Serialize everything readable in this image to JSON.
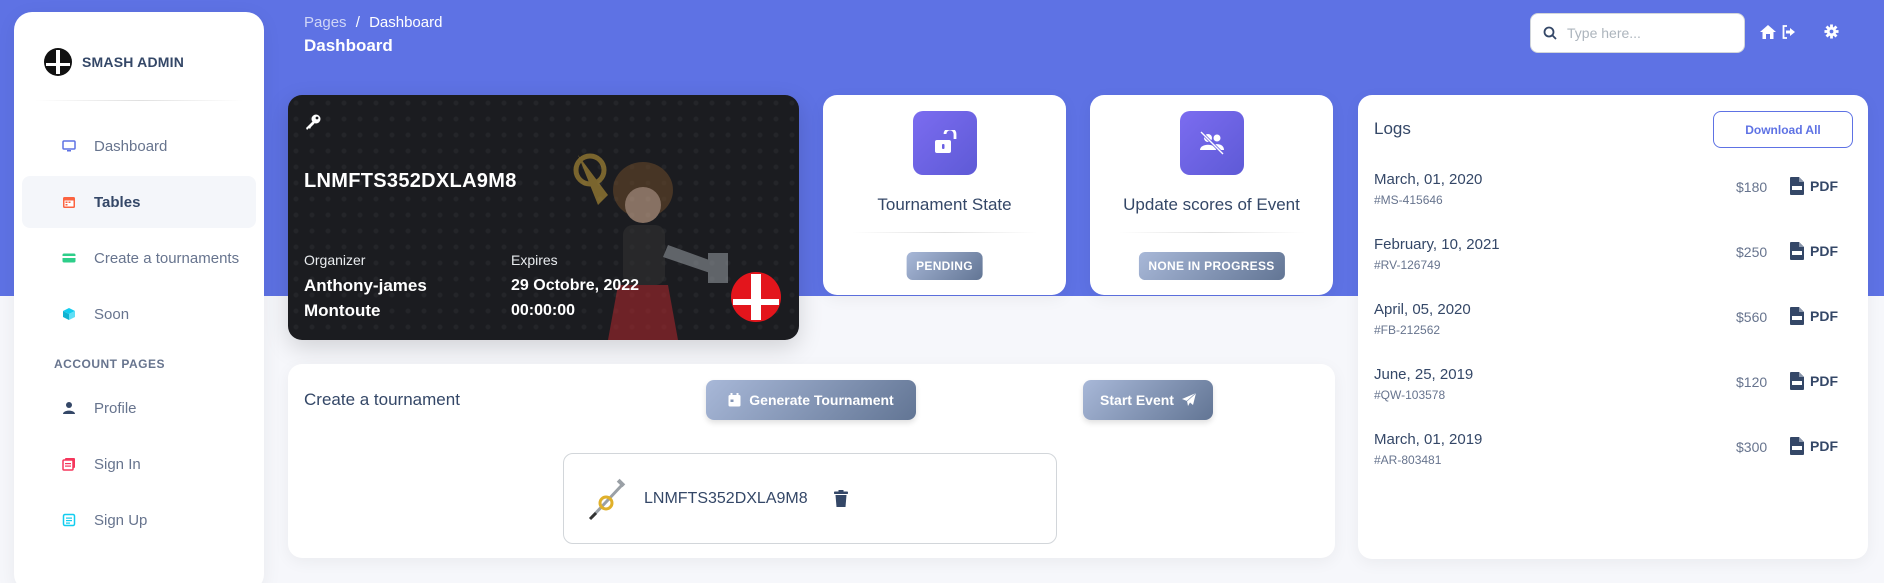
{
  "sidebar": {
    "brand": "SMASH ADMIN",
    "items": [
      {
        "label": "Dashboard",
        "icon": "desktop-icon",
        "color": "#5e72e4"
      },
      {
        "label": "Tables",
        "icon": "calendar-icon",
        "color": "#fb6340"
      },
      {
        "label": "Create a tournaments",
        "icon": "credit-card-icon",
        "color": "#2dce89"
      },
      {
        "label": "Soon",
        "icon": "cube-icon",
        "color": "#11cdef"
      }
    ],
    "section_label": "ACCOUNT PAGES",
    "account_items": [
      {
        "label": "Profile",
        "icon": "user-icon",
        "color": "#344767"
      },
      {
        "label": "Sign In",
        "icon": "sign-in-icon",
        "color": "#f5365c"
      },
      {
        "label": "Sign Up",
        "icon": "sign-up-icon",
        "color": "#11cdef"
      }
    ]
  },
  "header": {
    "breadcrumb_parent": "Pages",
    "breadcrumb_sep": "/",
    "breadcrumb_current": "Dashboard",
    "title": "Dashboard",
    "search_placeholder": "Type here..."
  },
  "key_card": {
    "code": "LNMFTS352DXLA9M8",
    "organizer_label": "Organizer",
    "organizer_line1": "Anthony-james",
    "organizer_line2": "Montoute",
    "expires_label": "Expires",
    "expires_date": "29 Octobre, 2022",
    "expires_time": "00:00:00"
  },
  "stats": [
    {
      "title": "Tournament State",
      "badge": "PENDING",
      "icon": "unlock-icon"
    },
    {
      "title": "Update scores of Event",
      "badge": "NONE IN PROGRESS",
      "icon": "users-slash-icon"
    }
  ],
  "create": {
    "title": "Create a tournament",
    "generate_label": "Generate Tournament",
    "start_label": "Start Event",
    "item_name": "LNMFTS352DXLA9M8"
  },
  "logs": {
    "title": "Logs",
    "download_label": "Download All",
    "pdf_label": "PDF",
    "rows": [
      {
        "date": "March, 01, 2020",
        "id": "#MS-415646",
        "amount": "$180"
      },
      {
        "date": "February, 10, 2021",
        "id": "#RV-126749",
        "amount": "$250"
      },
      {
        "date": "April, 05, 2020",
        "id": "#FB-212562",
        "amount": "$560"
      },
      {
        "date": "June, 25, 2019",
        "id": "#QW-103578",
        "amount": "$120"
      },
      {
        "date": "March, 01, 2019",
        "id": "#AR-803481",
        "amount": "$300"
      }
    ]
  },
  "colors": {
    "banner": "#5e72e4",
    "accent": "#5e72e4",
    "badge_gradient_start": "#a8b8d8",
    "badge_gradient_end": "#627594"
  }
}
